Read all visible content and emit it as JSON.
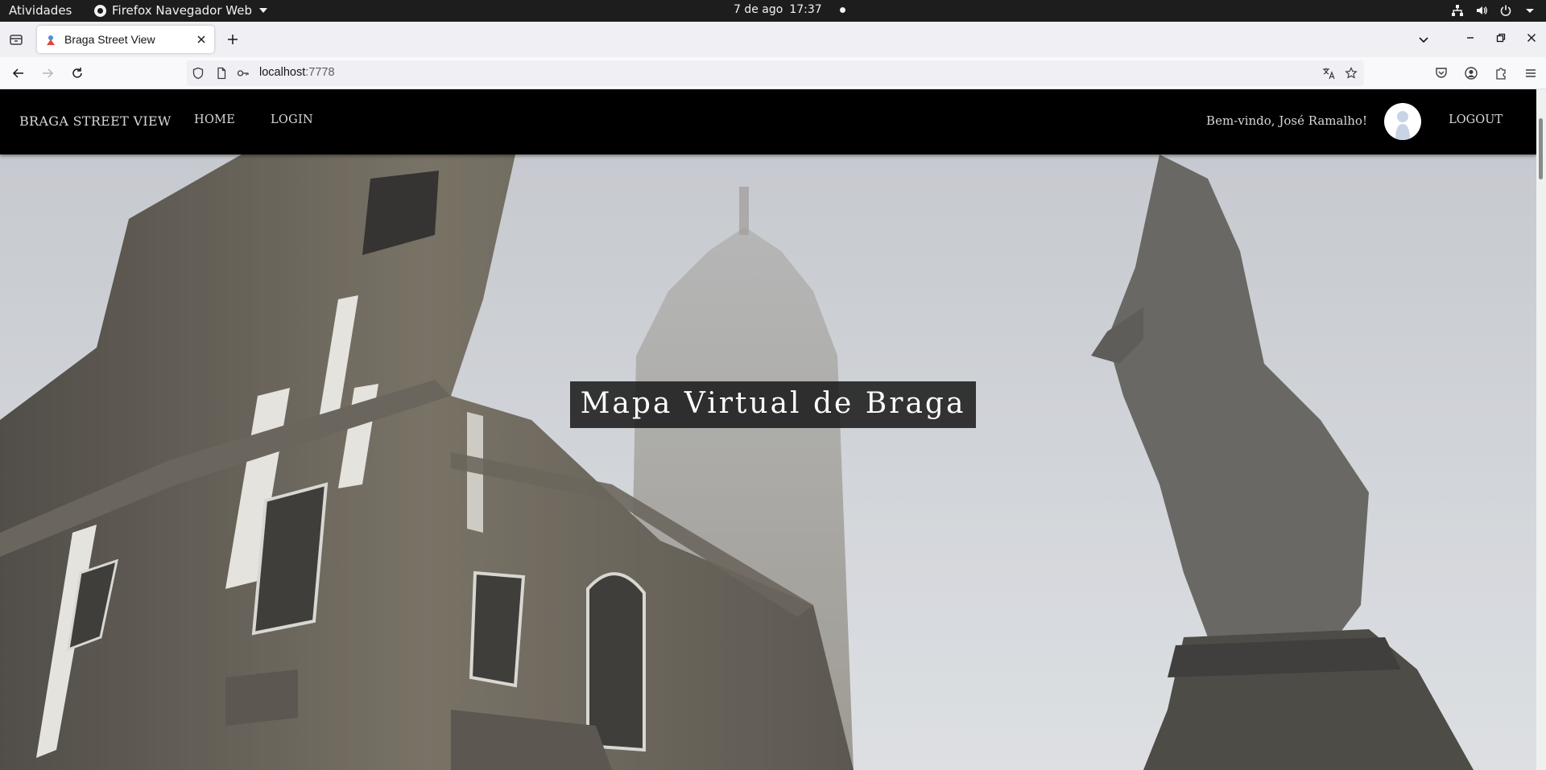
{
  "system_bar": {
    "activities": "Atividades",
    "app_name": "Firefox Navegador Web",
    "date": "7 de ago",
    "time": "17:37",
    "tray_icons": [
      "network-icon",
      "volume-icon",
      "power-icon",
      "chevron-down-icon"
    ]
  },
  "browser": {
    "tab": {
      "title": "Braga Street View",
      "favicon": "page-favicon"
    },
    "url": {
      "host": "localhost",
      "port": ":7778"
    },
    "nav_icons": [
      "back-icon",
      "forward-icon",
      "reload-icon"
    ],
    "url_icons": [
      "shield-icon",
      "page-icon",
      "key-icon"
    ],
    "right_icons": [
      "translate-icon",
      "star-icon",
      "pocket-icon",
      "account-icon",
      "extensions-icon",
      "menu-icon"
    ]
  },
  "site": {
    "brand": "BRAGA STREET VIEW",
    "nav": [
      "HOME",
      "LOGIN"
    ],
    "welcome": "Bem-vindo, José Ramalho!",
    "logout": "LOGOUT",
    "hero_title": "Mapa Virtual de Braga",
    "colors": {
      "nav_bg": "#000000",
      "title_box": "#1c1c1c"
    }
  }
}
